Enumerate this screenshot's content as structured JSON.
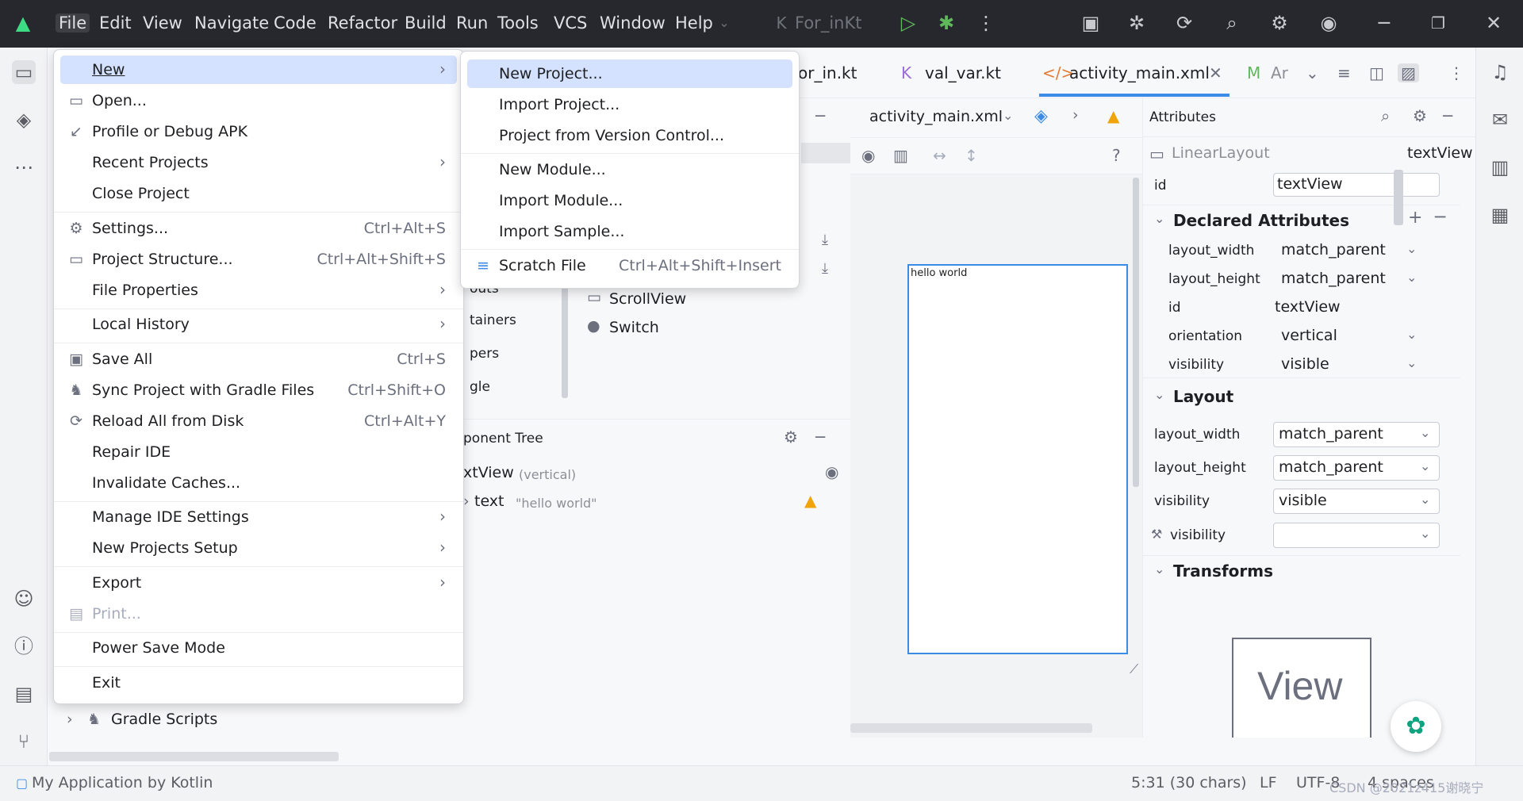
{
  "titlebar": {
    "menus": [
      "File",
      "Edit",
      "View",
      "Navigate",
      "Code",
      "Refactor",
      "Build",
      "Run",
      "Tools",
      "VCS",
      "Window",
      "Help"
    ],
    "run_config": "For_inKt"
  },
  "editor_tabs": [
    "or_in.kt",
    "val_var.kt",
    "activity_main.xml",
    "Ar"
  ],
  "design_toolbar": {
    "file": "activity_main.xml"
  },
  "phone_text": "hello world",
  "palette": {
    "items": [
      "ScrollView",
      "Switch"
    ],
    "categories": [
      "outs",
      "tainers",
      "pers",
      "gle"
    ]
  },
  "component_tree": {
    "title": "ponent Tree",
    "root": "xtView",
    "root_hint": "(vertical)",
    "child_label": "text",
    "child_value": "\"hello world\""
  },
  "attributes": {
    "title": "Attributes",
    "component_type": "LinearLayout",
    "component_name": "textView",
    "id_label": "id",
    "id_value": "textView",
    "declared_title": "Declared Attributes",
    "declared": [
      {
        "name": "layout_width",
        "value": "match_parent"
      },
      {
        "name": "layout_height",
        "value": "match_parent"
      },
      {
        "name": "id",
        "value": "textView"
      },
      {
        "name": "orientation",
        "value": "vertical"
      },
      {
        "name": "visibility",
        "value": "visible"
      }
    ],
    "layout_title": "Layout",
    "layout": [
      {
        "name": "layout_width",
        "value": "match_parent"
      },
      {
        "name": "layout_height",
        "value": "match_parent"
      },
      {
        "name": "visibility",
        "value": "visible"
      },
      {
        "name": "visibility",
        "value": ""
      }
    ],
    "transforms_title": "Transforms",
    "preview_text": "View"
  },
  "project_tree": {
    "gradle": "Gradle Scripts"
  },
  "statusbar": {
    "project": "My Application by Kotlin",
    "position": "5:31 (30 chars)",
    "line_sep": "LF",
    "encoding": "UTF-8",
    "indent": "4 spaces",
    "watermark": "CSDN @2021z415谢晓宁"
  },
  "file_menu": {
    "items": [
      {
        "label": "New",
        "shortcut": "",
        "submenu": true
      },
      {
        "label": "Open...",
        "shortcut": "",
        "submenu": false
      },
      {
        "label": "Profile or Debug APK",
        "shortcut": "",
        "submenu": false
      },
      {
        "label": "Recent Projects",
        "shortcut": "",
        "submenu": true
      },
      {
        "label": "Close Project",
        "shortcut": "",
        "submenu": false
      },
      {
        "label": "Settings...",
        "shortcut": "Ctrl+Alt+S",
        "submenu": false
      },
      {
        "label": "Project Structure...",
        "shortcut": "Ctrl+Alt+Shift+S",
        "submenu": false
      },
      {
        "label": "File Properties",
        "shortcut": "",
        "submenu": true
      },
      {
        "label": "Local History",
        "shortcut": "",
        "submenu": true
      },
      {
        "label": "Save All",
        "shortcut": "Ctrl+S",
        "submenu": false
      },
      {
        "label": "Sync Project with Gradle Files",
        "shortcut": "Ctrl+Shift+O",
        "submenu": false
      },
      {
        "label": "Reload All from Disk",
        "shortcut": "Ctrl+Alt+Y",
        "submenu": false
      },
      {
        "label": "Repair IDE",
        "shortcut": "",
        "submenu": false
      },
      {
        "label": "Invalidate Caches...",
        "shortcut": "",
        "submenu": false
      },
      {
        "label": "Manage IDE Settings",
        "shortcut": "",
        "submenu": true
      },
      {
        "label": "New Projects Setup",
        "shortcut": "",
        "submenu": true
      },
      {
        "label": "Export",
        "shortcut": "",
        "submenu": true
      },
      {
        "label": "Print...",
        "shortcut": "",
        "submenu": false
      },
      {
        "label": "Power Save Mode",
        "shortcut": "",
        "submenu": false
      },
      {
        "label": "Exit",
        "shortcut": "",
        "submenu": false
      }
    ]
  },
  "new_submenu": {
    "items": [
      {
        "label": "New Project...",
        "shortcut": ""
      },
      {
        "label": "Import Project...",
        "shortcut": ""
      },
      {
        "label": "Project from Version Control...",
        "shortcut": ""
      },
      {
        "label": "New Module...",
        "shortcut": ""
      },
      {
        "label": "Import Module...",
        "shortcut": ""
      },
      {
        "label": "Import Sample...",
        "shortcut": ""
      },
      {
        "label": "Scratch File",
        "shortcut": "Ctrl+Alt+Shift+Insert"
      }
    ]
  },
  "colors": {
    "accent": "#3c8ce7",
    "selection": "#d4e2ff",
    "titlebar": "#27282e",
    "warning": "#f0a30a"
  }
}
